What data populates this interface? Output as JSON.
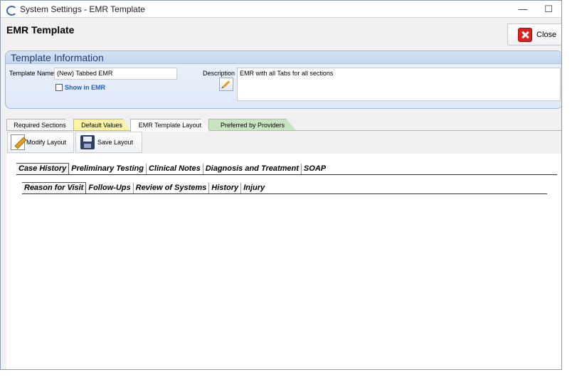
{
  "window": {
    "title": "System Settings - EMR Template",
    "minimize": "—",
    "maximize": "☐"
  },
  "header": {
    "title": "EMR Template",
    "close_label": "Close"
  },
  "template_info": {
    "heading": "Template Information",
    "name_label": "Template Name",
    "name_value": "(New) Tabbed EMR",
    "show_in_emr_label": "Show in EMR",
    "show_in_emr_checked": false,
    "description_label": "Description",
    "description_value": "EMR with all Tabs for all sections"
  },
  "tabs": [
    {
      "label": "Required Sections",
      "color": "#f5f5f5"
    },
    {
      "label": "Default Values",
      "color": "#fbf4a6"
    },
    {
      "label": "EMR Template Layout",
      "color": "#ffffff",
      "active": true
    },
    {
      "label": "Preferred by Providers",
      "color": "#c9e5c0"
    }
  ],
  "toolbar": {
    "modify_label": "Modify Layout",
    "save_label": "Save Layout"
  },
  "layout_tabs": {
    "level1": [
      "Case History",
      "Preliminary Testing",
      "Clinical Notes",
      "Diagnosis and Treatment",
      "SOAP"
    ],
    "level2": [
      "Reason for Visit",
      "Follow-Ups",
      "Review of Systems",
      "History",
      "Injury"
    ]
  }
}
